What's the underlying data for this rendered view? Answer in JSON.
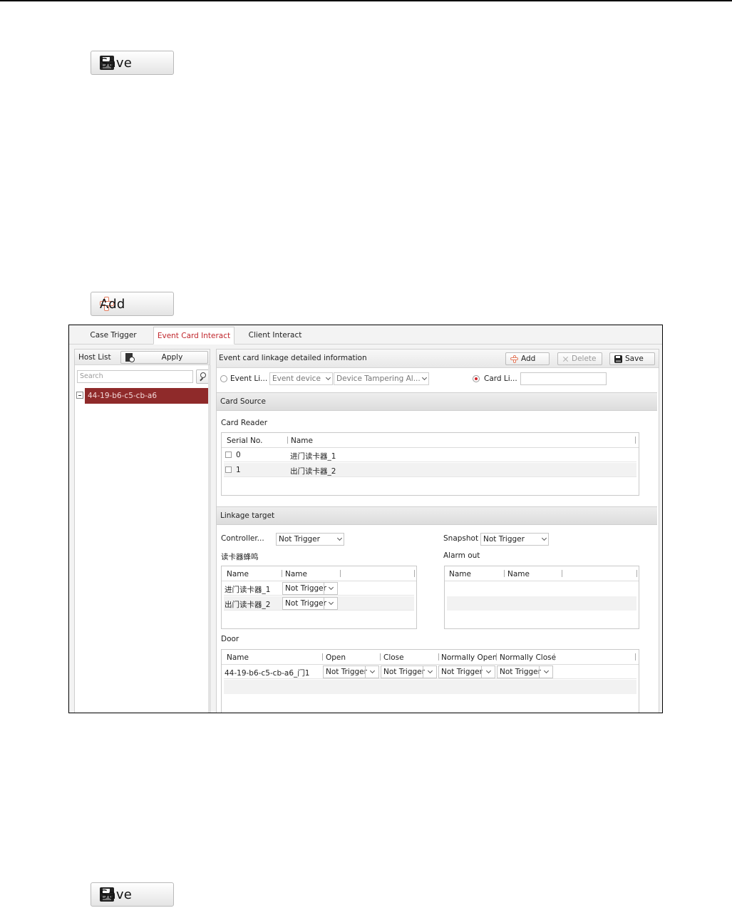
{
  "top_save_label": "Save",
  "add_label": "Add",
  "bottom_save_label": "Save",
  "tabs": [
    "Case Trigger",
    "Event Card Interact",
    "Client Interact"
  ],
  "active_tab": "Event Card Interact",
  "host_list": {
    "title": "Host List",
    "apply_label": "Apply",
    "search_placeholder": "Search",
    "items": [
      "44-19-b6-c5-cb-a6"
    ]
  },
  "detail": {
    "title": "Event card linkage detailed information",
    "add_label": "Add",
    "delete_label": "Delete",
    "save_label": "Save",
    "event_linkage_label": "Event Li...",
    "event_device": "Event device",
    "event_type": "Device Tampering Al...",
    "card_linkage_label": "Card Li...",
    "card_linkage_selected": true,
    "card_linkage_value": ""
  },
  "card_source": {
    "title": "Card Source",
    "card_reader_label": "Card Reader",
    "columns": [
      "Serial No.",
      "Name"
    ],
    "rows": [
      {
        "serial": "0",
        "name": "进门读卡器_1"
      },
      {
        "serial": "1",
        "name": "出门读卡器_2"
      }
    ]
  },
  "linkage_target": {
    "title": "Linkage target",
    "controller_label": "Controller...",
    "controller_value": "Not Trigger",
    "snapshot_label": "Snapshot",
    "snapshot_value": "Not Trigger",
    "buzzer_label": "读卡器蜂鸣",
    "buzzer_columns": [
      "Name",
      "Name"
    ],
    "buzzer_rows": [
      {
        "name": "进门读卡器_1",
        "value": "Not Trigger"
      },
      {
        "name": "出门读卡器_2",
        "value": "Not Trigger"
      }
    ],
    "alarm_out_label": "Alarm out",
    "alarm_columns": [
      "Name",
      "Name"
    ],
    "door_label": "Door",
    "door_columns": [
      "Name",
      "Open",
      "Close",
      "Normally Open",
      "Normally Close"
    ],
    "door_rows": [
      {
        "name": "44-19-b6-c5-cb-a6_门1",
        "open": "Not Trigger",
        "close": "Not Trigger",
        "normally_open": "Not Trigger",
        "normally_close": "Not Trigger"
      }
    ]
  }
}
